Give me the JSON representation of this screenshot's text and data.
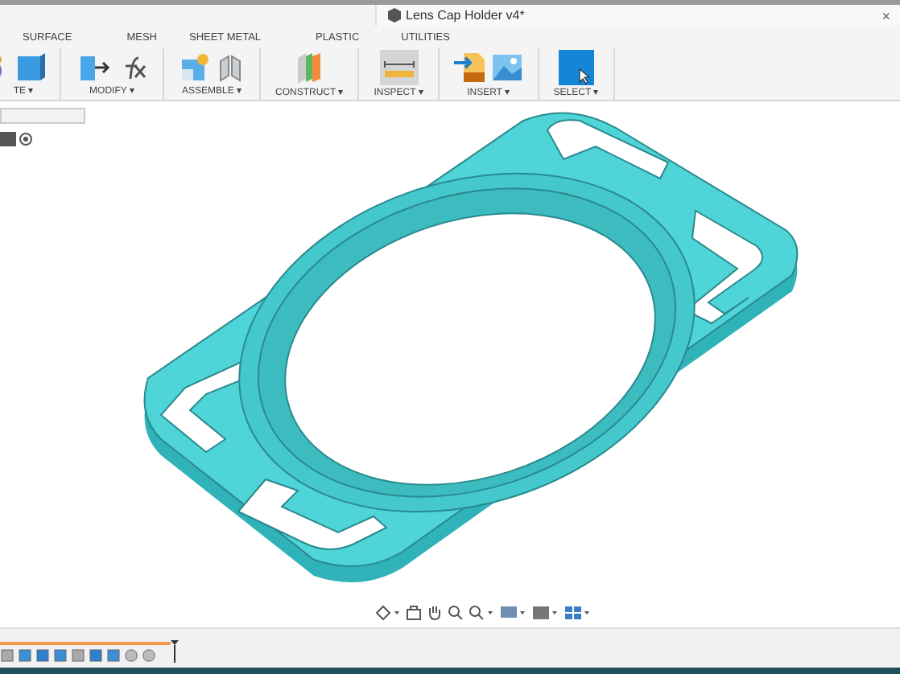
{
  "document_tab": {
    "title": "Lens Cap Holder v4*",
    "close": "×"
  },
  "workspace_tabs": [
    {
      "label": "SURFACE"
    },
    {
      "label": "MESH"
    },
    {
      "label": "SHEET METAL"
    },
    {
      "label": "PLASTIC"
    },
    {
      "label": "UTILITIES"
    }
  ],
  "toolbar_groups": [
    {
      "label": "TE ▾",
      "kind": "create"
    },
    {
      "label": "MODIFY ▾",
      "kind": "modify"
    },
    {
      "label": "ASSEMBLE ▾",
      "kind": "assemble"
    },
    {
      "label": "CONSTRUCT ▾",
      "kind": "construct"
    },
    {
      "label": "INSPECT ▾",
      "kind": "inspect"
    },
    {
      "label": "INSERT ▾",
      "kind": "insert"
    },
    {
      "label": "SELECT ▾",
      "kind": "select"
    }
  ]
}
